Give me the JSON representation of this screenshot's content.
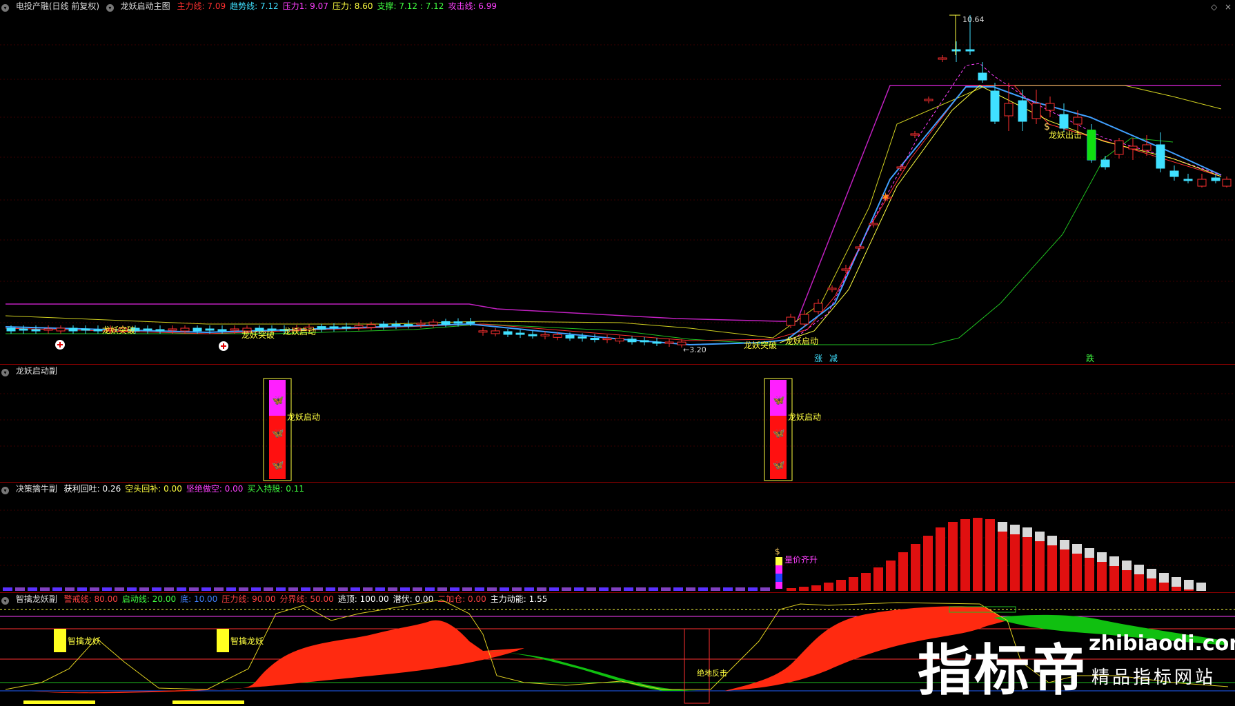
{
  "main_panel": {
    "stock_name": "电投产融(日线 前复权)",
    "indicator_name": "龙妖启动主图",
    "values": [
      {
        "label": "主力线:",
        "value": "7.09",
        "color": "#ff3030"
      },
      {
        "label": "趋势线:",
        "value": "7.12",
        "color": "#40e0ff"
      },
      {
        "label": "压力1:",
        "value": "9.07",
        "color": "#ff40ff"
      },
      {
        "label": "压力:",
        "value": "8.60",
        "color": "#ffff40"
      },
      {
        "label": "支撑:",
        "value": "7.12 : 7.12",
        "color": "#40ff40"
      },
      {
        "label": "攻击线:",
        "value": "6.99",
        "color": "#ff40ff"
      }
    ],
    "high_label": "10.64",
    "low_label": "←3.20",
    "annotations": [
      "龙妖突破",
      "龙妖突破",
      "龙妖启动",
      "龙妖突破",
      "龙妖启动",
      "龙妖出击"
    ],
    "bottom_markers": [
      "涨",
      "减",
      "跌"
    ],
    "controls": {
      "diamond": "◇",
      "close": "×"
    }
  },
  "sub1_panel": {
    "indicator_name": "龙妖启动副",
    "labels": [
      "龙妖启动",
      "龙妖启动"
    ]
  },
  "sub2_panel": {
    "indicator_name": "决策擒牛副",
    "values": [
      {
        "label": "获利回吐:",
        "value": "0.26",
        "color": "#ffffff"
      },
      {
        "label": "空头回补:",
        "value": "0.00",
        "color": "#ffff40"
      },
      {
        "label": "坚绝做空:",
        "value": "0.00",
        "color": "#ff40ff"
      },
      {
        "label": "买入持股:",
        "value": "0.11",
        "color": "#40ff40"
      }
    ],
    "signal_label": "量价齐升"
  },
  "sub3_panel": {
    "indicator_name": "智擒龙妖副",
    "values": [
      {
        "label": "警戒线:",
        "value": "80.00",
        "color": "#ff4040"
      },
      {
        "label": "启动线:",
        "value": "20.00",
        "color": "#40ff40"
      },
      {
        "label": "底:",
        "value": "10.00",
        "color": "#4080ff"
      },
      {
        "label": "压力线:",
        "value": "90.00",
        "color": "#ff4040"
      },
      {
        "label": "分界线:",
        "value": "50.00",
        "color": "#ff4040"
      },
      {
        "label": "逃顶:",
        "value": "100.00",
        "color": "#ffffff"
      },
      {
        "label": "潜伏:",
        "value": "0.00",
        "color": "#ffffff"
      },
      {
        "label": "二加仓:",
        "value": "0.00",
        "color": "#ff4040"
      },
      {
        "label": "主力动能:",
        "value": "1.55",
        "color": "#ffffff"
      }
    ],
    "labels": [
      "智擒龙妖",
      "智擒龙妖",
      "绝地反击"
    ]
  },
  "watermark": {
    "cn": "指标帝",
    "domain": "zhibiaodi.com",
    "slogan": "精品指标网站"
  },
  "colors": {
    "up": "#ff3030",
    "down": "#40e0ff",
    "border": "#8b0000",
    "yellow": "#ffff40",
    "magenta": "#ff40ff",
    "green": "#40ff40"
  }
}
